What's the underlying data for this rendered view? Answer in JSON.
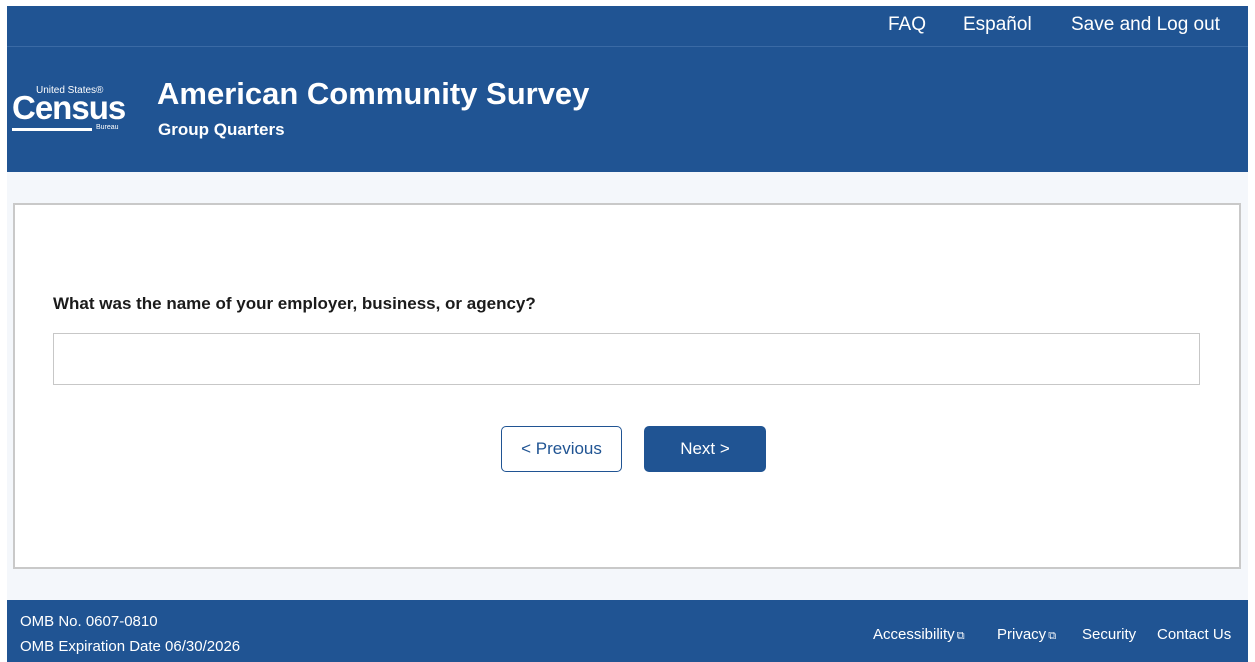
{
  "topnav": {
    "faq": "FAQ",
    "espanol": "Español",
    "save_logout": "Save and Log out"
  },
  "header": {
    "logo": {
      "united_states": "United States®",
      "census": "Census",
      "bureau": "Bureau"
    },
    "title": "American Community Survey",
    "subtitle": "Group Quarters"
  },
  "form": {
    "question": "What was the name of your employer, business, or agency?",
    "answer_value": "",
    "previous_label": "< Previous",
    "next_label": "Next >"
  },
  "footer": {
    "omb_number": "OMB No. 0607-0810",
    "omb_expiration": "OMB Expiration Date 06/30/2026",
    "links": {
      "accessibility": "Accessibility",
      "privacy": "Privacy",
      "security": "Security",
      "contact": "Contact Us"
    },
    "external_icon": "⧉"
  },
  "colors": {
    "brand_blue": "#205493",
    "page_background": "#f4f7fb"
  }
}
